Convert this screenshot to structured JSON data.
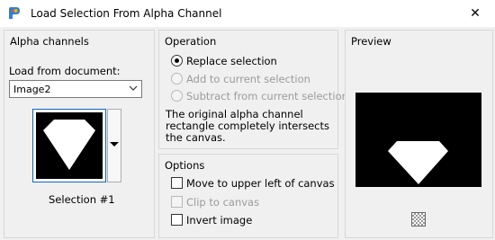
{
  "window": {
    "title": "Load Selection From Alpha Channel",
    "close_glyph": "✕"
  },
  "alpha_channels": {
    "heading": "Alpha channels",
    "load_from_label": "Load from document:",
    "document_value": "Image2",
    "thumbnail_label": "Selection #1"
  },
  "operation": {
    "heading": "Operation",
    "options": [
      {
        "label": "Replace selection",
        "selected": true,
        "enabled": true
      },
      {
        "label": "Add to current selection",
        "selected": false,
        "enabled": false
      },
      {
        "label": "Subtract from current selection",
        "selected": false,
        "enabled": false
      }
    ],
    "note": "The original alpha channel rectangle completely intersects the canvas."
  },
  "options": {
    "heading": "Options",
    "items": [
      {
        "label": "Move to upper left of canvas",
        "checked": false,
        "enabled": true
      },
      {
        "label": "Clip to canvas",
        "checked": false,
        "enabled": false
      },
      {
        "label": "Invert image",
        "checked": false,
        "enabled": true
      }
    ]
  },
  "preview": {
    "heading": "Preview",
    "icon": "checkerboard-icon"
  },
  "colors": {
    "accent": "#0b66c6",
    "disabled_text": "#9b9b9b"
  }
}
